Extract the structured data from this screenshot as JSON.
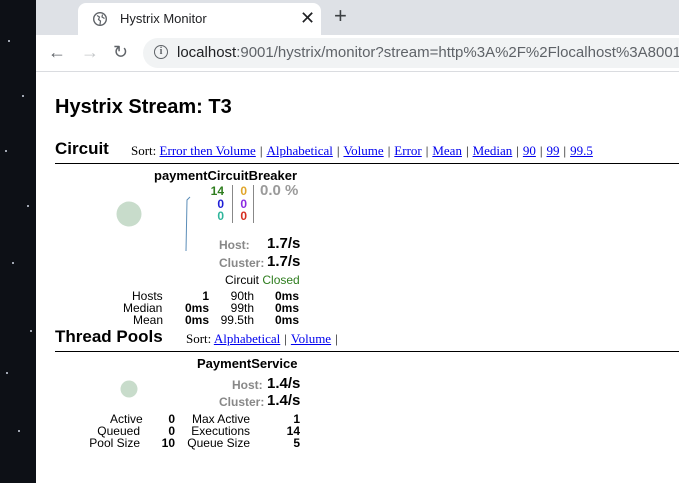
{
  "browser": {
    "tab_title": "Hystrix Monitor",
    "url_host": "localhost",
    "url_rest": ":9001/hystrix/monitor?stream=http%3A%2F%2Flocalhost%3A8001"
  },
  "page": {
    "title": "Hystrix Stream: T3"
  },
  "circuit": {
    "heading": "Circuit",
    "sort_label": "Sort:",
    "sort_options": [
      "Error then Volume",
      "Alphabetical",
      "Volume",
      "Error",
      "Mean",
      "Median",
      "90",
      "99",
      "99.5"
    ],
    "name": "paymentCircuitBreaker",
    "counts_left": [
      "14",
      "0",
      "0"
    ],
    "counts_right": [
      "0",
      "0",
      "0"
    ],
    "error_pct": "0.0 %",
    "host_label": "Host:",
    "host_rate": "1.7/s",
    "cluster_label": "Cluster:",
    "cluster_rate": "1.7/s",
    "status_label": "Circuit",
    "status_value": "Closed",
    "stats": {
      "hosts_label": "Hosts",
      "hosts": "1",
      "median_label": "Median",
      "median": "0ms",
      "mean_label": "Mean",
      "mean": "0ms",
      "p90_label": "90th",
      "p90": "0ms",
      "p99_label": "99th",
      "p99": "0ms",
      "p995_label": "99.5th",
      "p995": "0ms"
    }
  },
  "threadpools": {
    "heading": "Thread Pools",
    "sort_label": "Sort:",
    "sort_options": [
      "Alphabetical",
      "Volume"
    ],
    "name": "PaymentService",
    "host_label": "Host:",
    "host_rate": "1.4/s",
    "cluster_label": "Cluster:",
    "cluster_rate": "1.4/s",
    "stats": {
      "active_label": "Active",
      "active": "0",
      "queued_label": "Queued",
      "queued": "0",
      "poolsize_label": "Pool Size",
      "poolsize": "10",
      "maxactive_label": "Max Active",
      "maxactive": "1",
      "executions_label": "Executions",
      "executions": "14",
      "queuesize_label": "Queue Size",
      "queuesize": "5"
    }
  },
  "colors": {
    "success": "#2e7d1e",
    "short_circuited": "#1e1ed6",
    "bad_request": "#2fb59b",
    "timeout": "#e0a52a",
    "rejected": "#8a2be2",
    "failure": "#d62d20",
    "circle": "#c8dccb",
    "error_pct": "#9a9a9a"
  }
}
